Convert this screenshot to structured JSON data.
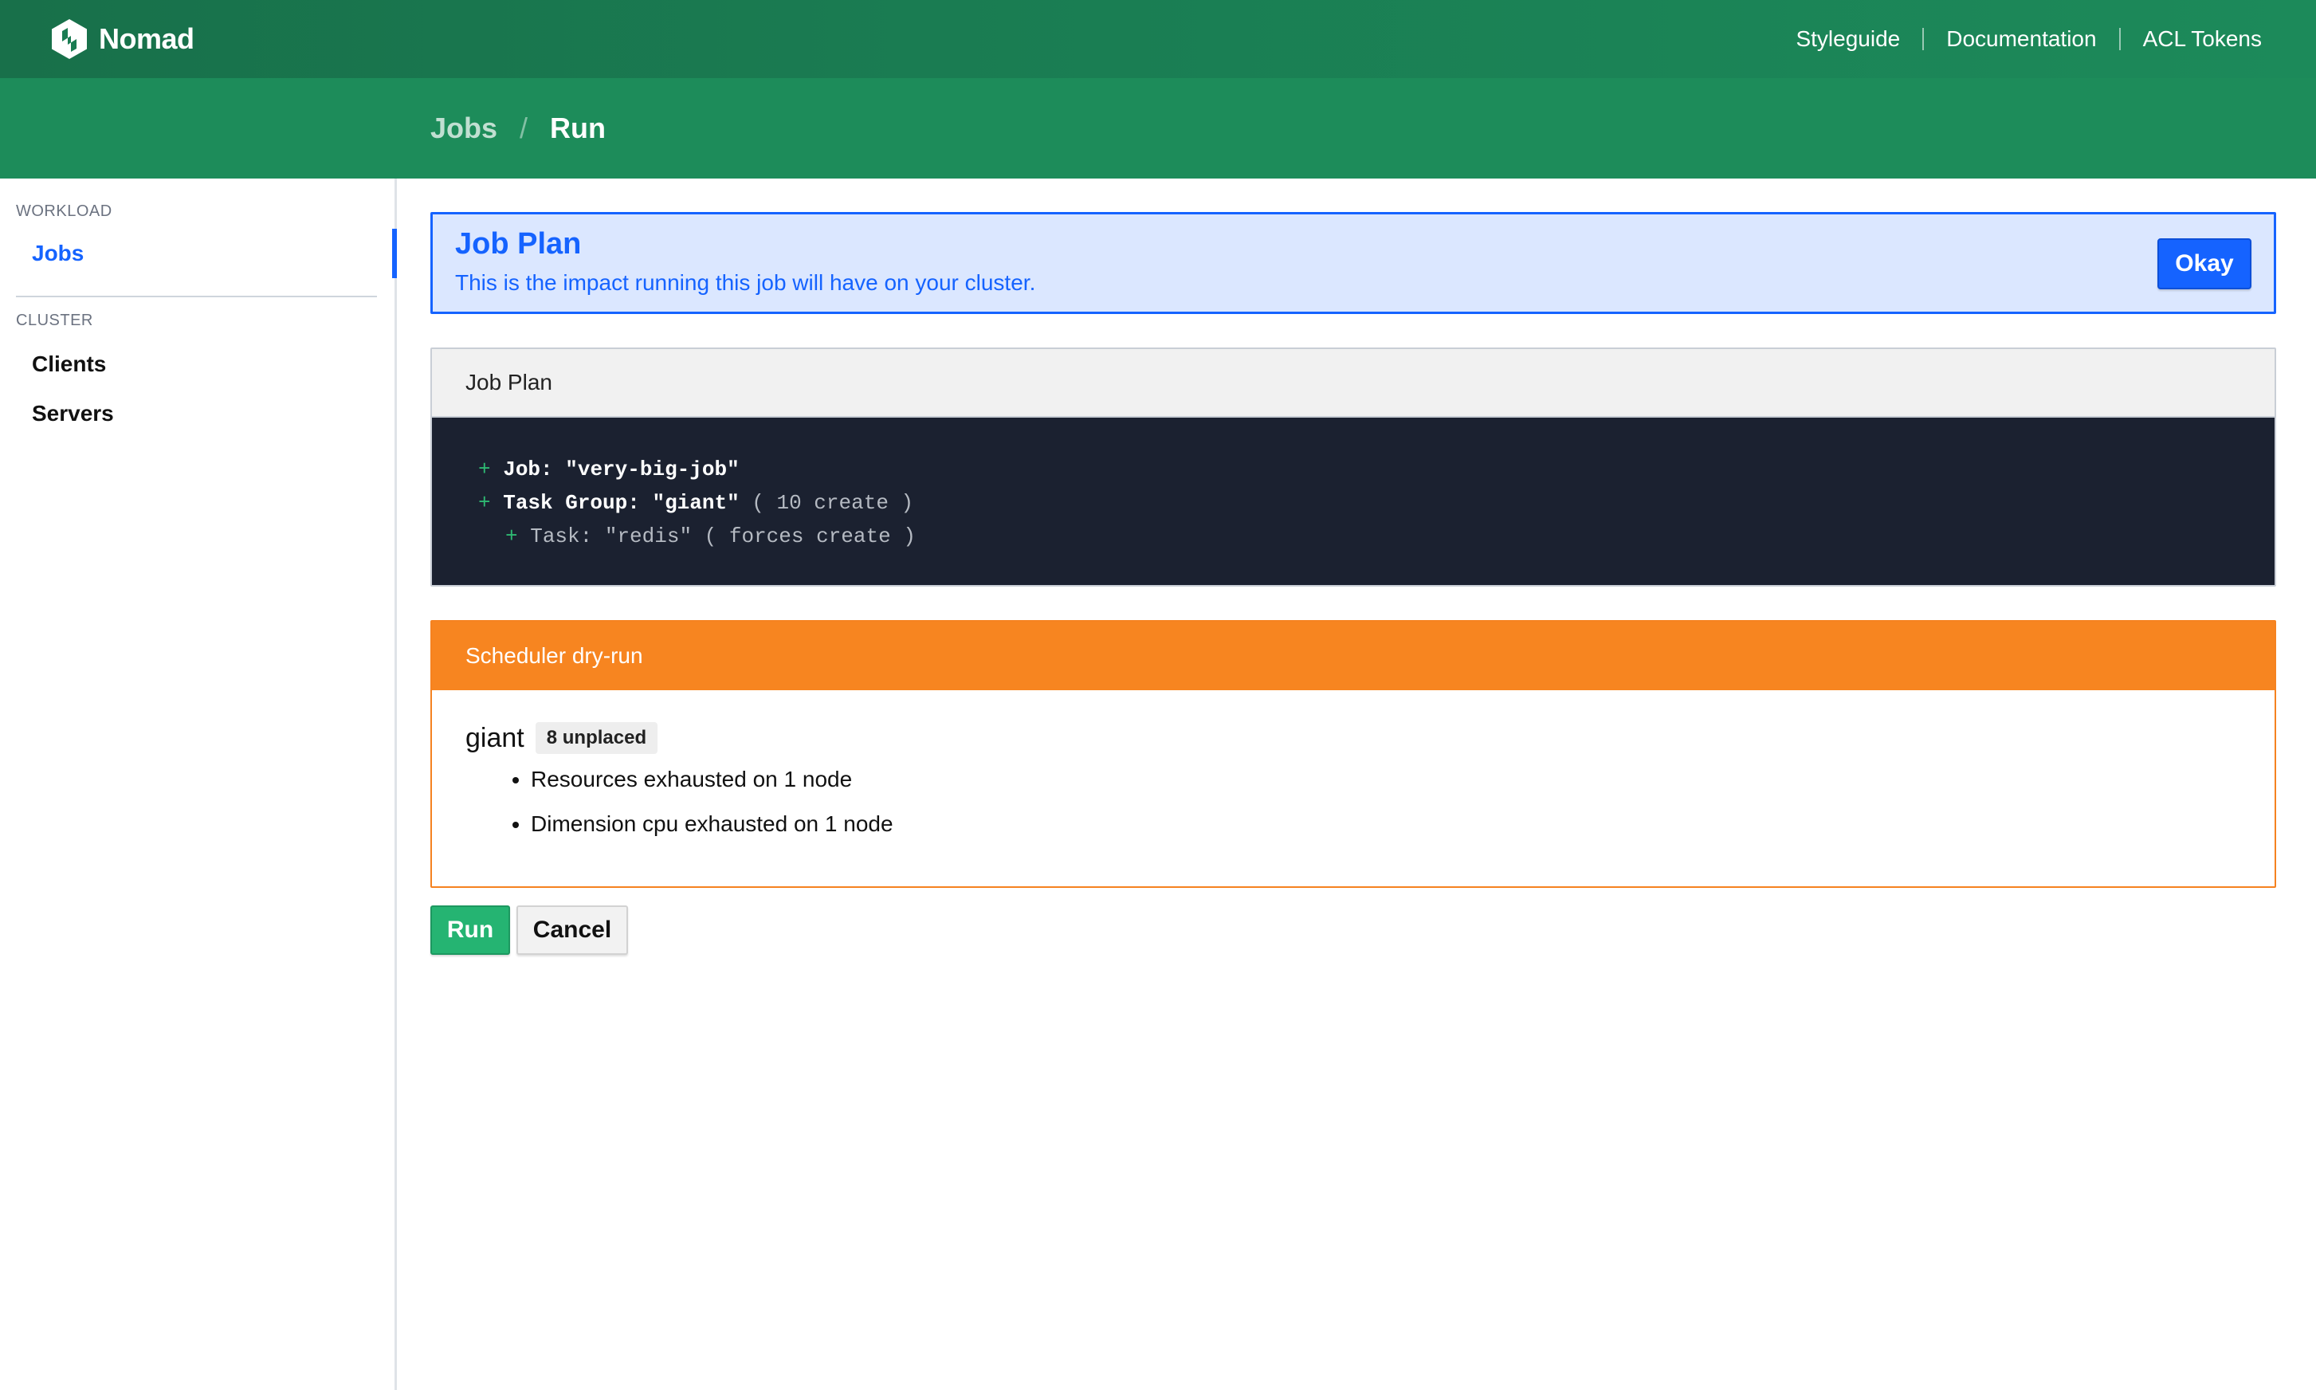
{
  "app": {
    "brand_name": "Nomad",
    "logo_icon": "nomad-hexagon-logo",
    "colors": {
      "topbar": "#1a7c52",
      "crumbbar": "#1d8c5a",
      "primary": "#1563ff",
      "success": "#25b472",
      "warning": "#f78520",
      "code_bg": "#1b2130"
    }
  },
  "topnav": {
    "links": [
      "Styleguide",
      "Documentation",
      "ACL Tokens"
    ]
  },
  "breadcrumb": {
    "parent": "Jobs",
    "separator": "/",
    "current": "Run"
  },
  "sidebar": {
    "sections": [
      {
        "label": "WORKLOAD",
        "items": [
          "Jobs"
        ]
      },
      {
        "label": "CLUSTER",
        "items": [
          "Clients",
          "Servers"
        ]
      }
    ],
    "active_item": "Jobs"
  },
  "notice": {
    "title": "Job Plan",
    "body": "This is the impact running this job will have on your cluster.",
    "okay_label": "Okay"
  },
  "plan": {
    "header": "Job Plan",
    "lines": [
      {
        "prefix": "+",
        "key": "Job:",
        "name": "\"very-big-job\"",
        "annotation": ""
      },
      {
        "prefix": "+",
        "key": "Task Group:",
        "name": "\"giant\"",
        "annotation": "( 10 create )"
      },
      {
        "prefix": "+",
        "key": "Task:",
        "name": "\"redis\"",
        "annotation": "( forces create )"
      }
    ]
  },
  "dryrun": {
    "header": "Scheduler dry-run",
    "group": "giant",
    "badge": "8 unplaced",
    "reasons": [
      "Resources exhausted on 1 node",
      "Dimension cpu exhausted on 1 node"
    ]
  },
  "actions": {
    "run_label": "Run",
    "cancel_label": "Cancel"
  }
}
